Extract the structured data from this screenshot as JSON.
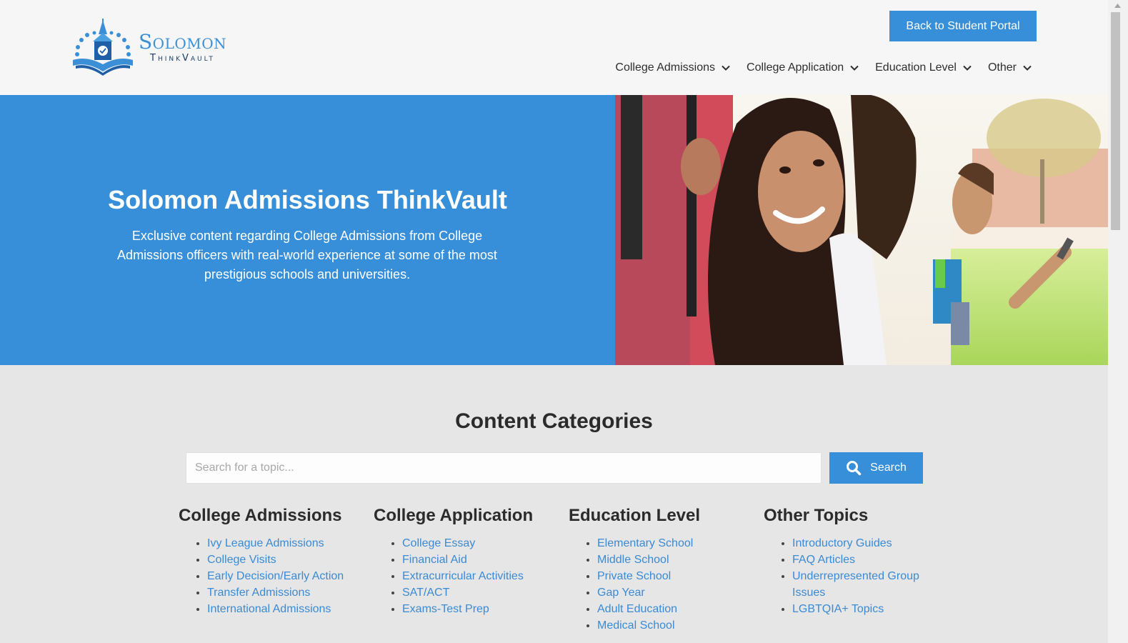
{
  "header": {
    "logo": {
      "title": "Solomon",
      "subtitle": "ThinkVault",
      "icon": "clock-tower-book-logo-icon"
    },
    "portal_button": "Back to Student Portal",
    "nav": [
      {
        "label": "College Admissions",
        "icon": "chevron-down-icon"
      },
      {
        "label": "College Application",
        "icon": "chevron-down-icon"
      },
      {
        "label": "Education Level",
        "icon": "chevron-down-icon"
      },
      {
        "label": "Other",
        "icon": "chevron-down-icon"
      }
    ]
  },
  "hero": {
    "title": "Solomon Admissions ThinkVault",
    "description": "Exclusive content regarding College Admissions from College Admissions officers with real-world experience at some of the most prestigious schools and universities.",
    "image_alt": "Smiling students outdoors on campus"
  },
  "content": {
    "title": "Content Categories",
    "search": {
      "placeholder": "Search for a topic...",
      "value": "",
      "button": "Search",
      "icon": "search-icon"
    },
    "categories": [
      {
        "title": "College Admissions",
        "items": [
          "Ivy League Admissions",
          "College Visits",
          "Early Decision/Early Action",
          "Transfer Admissions",
          "International Admissions"
        ]
      },
      {
        "title": "College Application",
        "items": [
          "College Essay",
          "Financial Aid",
          "Extracurricular Activities",
          "SAT/ACT",
          "Exams-Test Prep"
        ]
      },
      {
        "title": "Education Level",
        "items": [
          "Elementary School",
          "Middle School",
          "Private School",
          "Gap Year",
          "Adult Education",
          "Medical School"
        ]
      },
      {
        "title": "Other Topics",
        "items": [
          "Introductory Guides",
          "FAQ Articles",
          "Underrepresented Group Issues",
          "LGBTQIA+ Topics"
        ]
      }
    ]
  },
  "colors": {
    "accent": "#378fd9",
    "link": "#3a8ad4",
    "header_bg": "#f6f6f6",
    "page_bg": "#e6e6e6",
    "heading": "#2b2b2b"
  }
}
